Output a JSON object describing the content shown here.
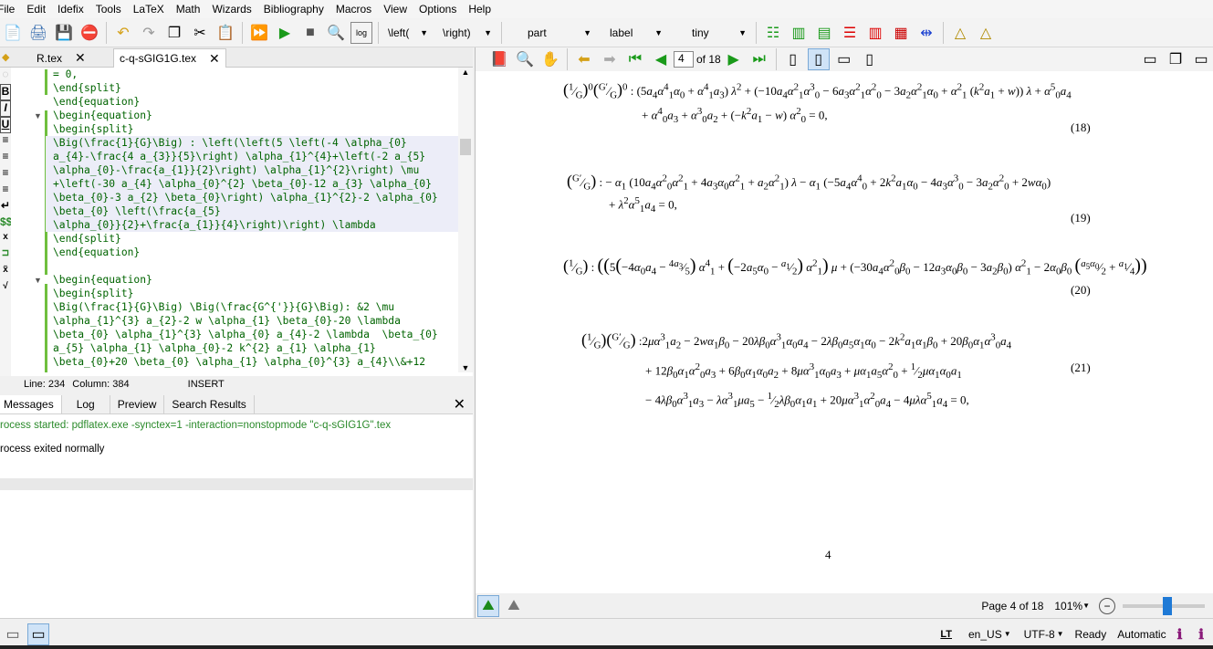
{
  "menu": [
    "File",
    "Edit",
    "Idefix",
    "Tools",
    "LaTeX",
    "Math",
    "Wizards",
    "Bibliography",
    "Macros",
    "View",
    "Options",
    "Help"
  ],
  "toolbar": {
    "left_combo": "\\left(",
    "right_combo": "\\right)",
    "part_combo": "part",
    "label_combo": "label",
    "size_combo": "tiny"
  },
  "editor": {
    "tabs": [
      {
        "label": "R.tex"
      },
      {
        "label": "c-q-sGIG1G.tex"
      }
    ],
    "code_lines": [
      "= 0,",
      "\\end{split}",
      "\\end{equation}",
      "\\begin{equation}",
      "\\begin{split}",
      "\\Big(\\frac{1}{G}\\Big) : \\left(\\left(5 \\left(-4 \\alpha_{0}",
      "a_{4}-\\frac{4 a_{3}}{5}\\right) \\alpha_{1}^{4}+\\left(-2 a_{5}",
      "\\alpha_{0}-\\frac{a_{1}}{2}\\right) \\alpha_{1}^{2}\\right) \\mu",
      "+\\left(-30 a_{4} \\alpha_{0}^{2} \\beta_{0}-12 a_{3} \\alpha_{0}",
      "\\beta_{0}-3 a_{2} \\beta_{0}\\right) \\alpha_{1}^{2}-2 \\alpha_{0}",
      "\\beta_{0} \\left(\\frac{a_{5}",
      "\\alpha_{0}}{2}+\\frac{a_{1}}{4}\\right)\\right) \\lambda",
      "\\end{split}",
      "\\end{equation}",
      "",
      "\\begin{equation}",
      "\\begin{split}",
      "\\Big(\\frac{1}{G}\\Big) \\Big(\\frac{G^{'}}{G}\\Big): &2 \\mu",
      "\\alpha_{1}^{3} a_{2}-2 w \\alpha_{1} \\beta_{0}-20 \\lambda",
      "\\beta_{0} \\alpha_{1}^{3} \\alpha_{0} a_{4}-2 \\lambda  \\beta_{0}",
      "a_{5} \\alpha_{1} \\alpha_{0}-2 k^{2} a_{1} \\alpha_{1}",
      "\\beta_{0}+20 \\beta_{0} \\alpha_{1} \\alpha_{0}^{3} a_{4}\\\\&+12"
    ],
    "status": {
      "line": "Line: 234",
      "column": "Column: 384",
      "mode": "INSERT"
    }
  },
  "messages": {
    "tabs": [
      "Messages",
      "Log",
      "Preview",
      "Search Results"
    ],
    "lines": [
      "rocess started: pdflatex.exe -synctex=1 -interaction=nonstopmode \"c-q-sGIG1G\".tex",
      "rocess exited normally"
    ]
  },
  "pdf": {
    "page_input": "4",
    "page_of": "of 18",
    "page_number_footer": "4",
    "equations": [
      {
        "num": "(18)"
      },
      {
        "num": "(19)"
      },
      {
        "num": "(20)"
      },
      {
        "num": "(21)"
      }
    ],
    "status_page": "Page 4 of 18",
    "zoom": "101%"
  },
  "bottom": {
    "language": "en_US",
    "encoding": "UTF-8",
    "state": "Ready",
    "mode": "Automatic"
  }
}
